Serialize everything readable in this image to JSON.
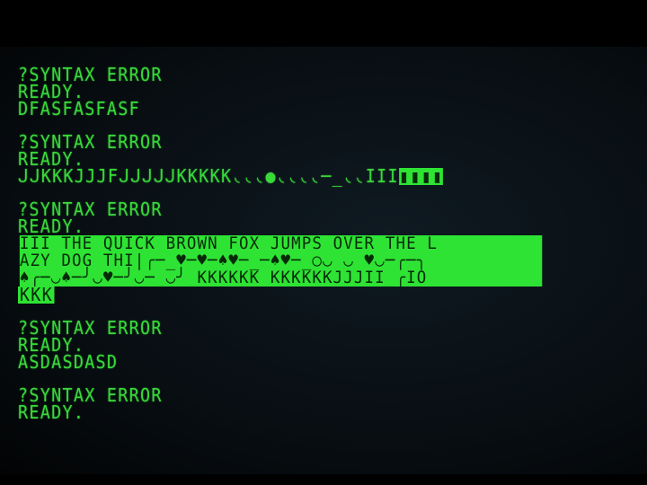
{
  "screen": {
    "block1": {
      "error": "?SYNTAX ERROR",
      "ready": "READY.",
      "input": "DFASFASFASF"
    },
    "block2": {
      "error": "?SYNTAX ERROR",
      "ready": "READY.",
      "input": "ᒍᒍKKKJJJFᒍᒍᒍᒍᒍKKKKK◟◟◟●◟◟◟◟─_◟◟III",
      "input_inverse": "▮▮▮▮"
    },
    "block3": {
      "error": "?SYNTAX ERROR",
      "ready": "READY.",
      "inverse_lines": [
        "III THE QUICK BROWN FOX JUMPS OVER THE L",
        "AZY DOG THI|╭─_♥─♥─♠♥─_─♠♥─_○◡ ◡ ♥◡─╭─╮",
        "♠╭─◡♠─╯◡♥─╯◡─_◡╯_KKKKKK KKKKKKJJJII_╭IO",
        "KKK"
      ]
    },
    "block4": {
      "error": "?SYNTAX ERROR",
      "ready": "READY.",
      "input": "ASDASDASD"
    },
    "block5": {
      "error": "?SYNTAX ERROR",
      "ready": "READY."
    }
  }
}
